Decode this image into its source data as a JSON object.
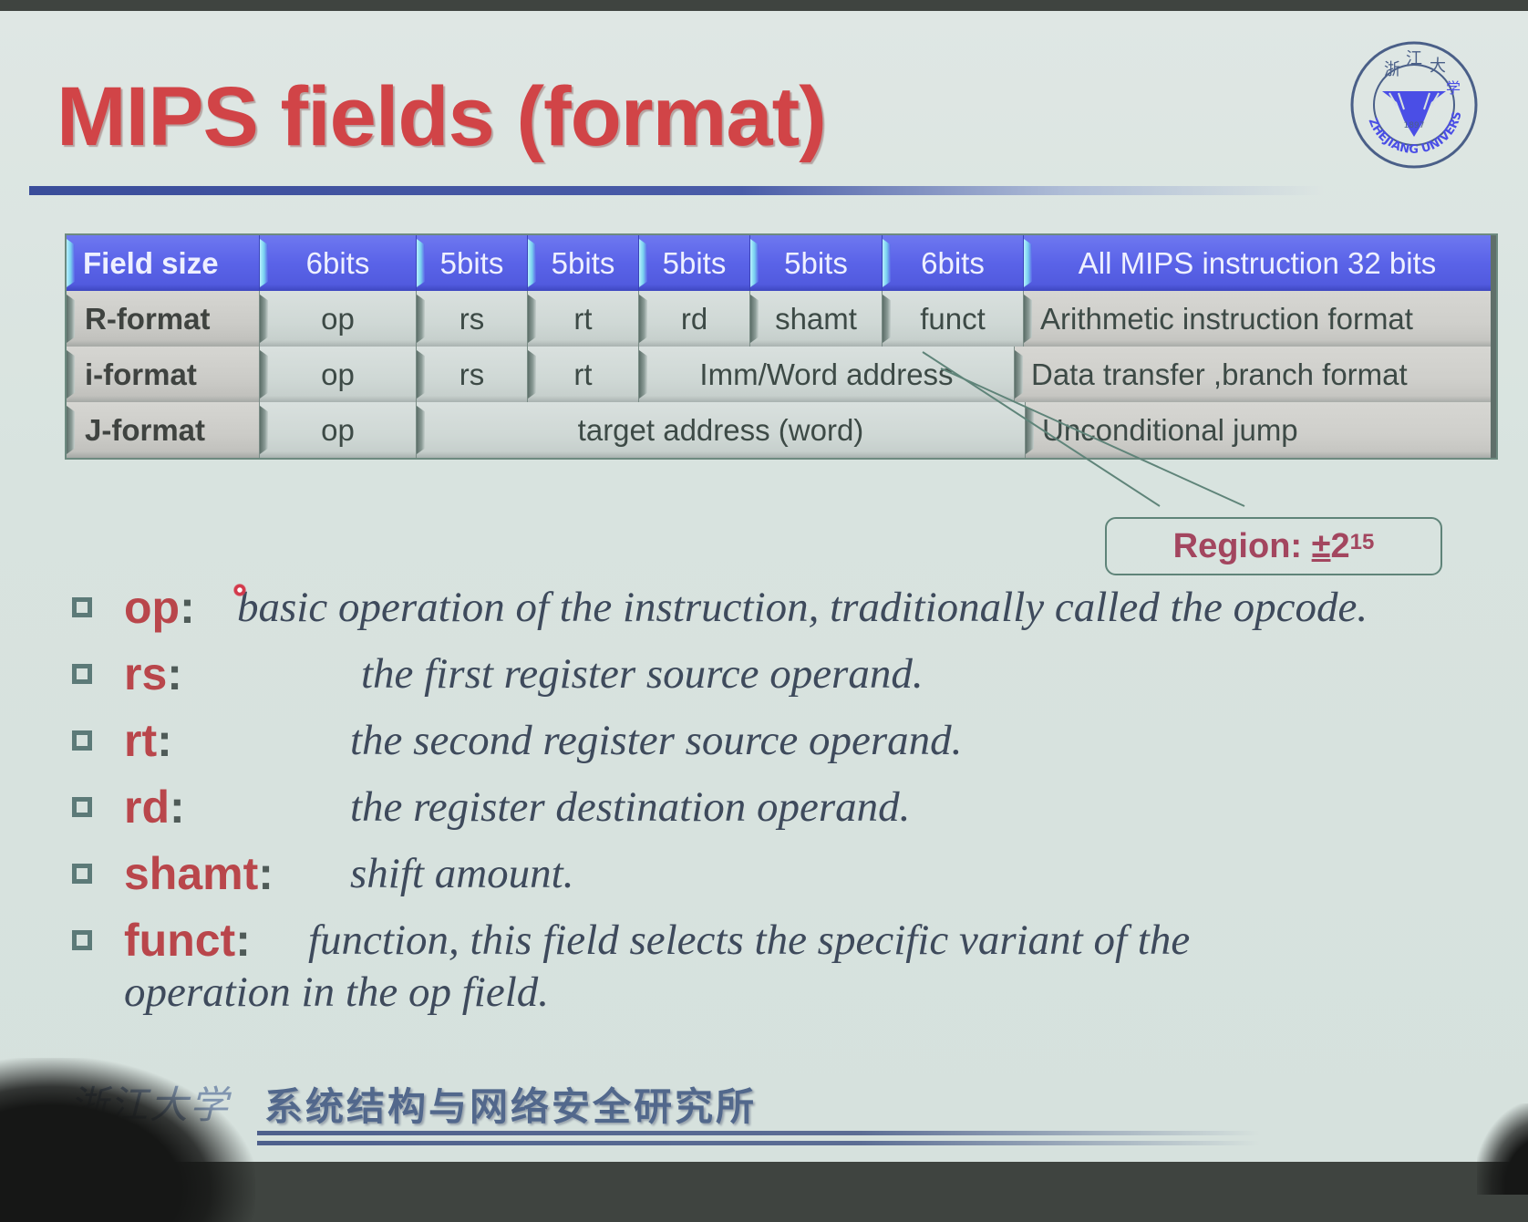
{
  "slide": {
    "title": "MIPS fields (format)",
    "logo": {
      "icon": "zhejiang-university-seal-icon",
      "text": "ZHEJIANG UNIVERSITY",
      "year": "1897",
      "accent": "#4a4ee6"
    },
    "colors": {
      "title": "#d14447",
      "header_fill": "#5a63e8",
      "key_text": "#b9464b",
      "desc_text": "#3e4a5c",
      "callout_text": "#a3465f"
    }
  },
  "table": {
    "header": {
      "label": "Field size",
      "cells": [
        "6bits",
        "5bits",
        "5bits",
        "5bits",
        "5bits",
        "6bits"
      ],
      "desc": "All MIPS instruction 32 bits"
    },
    "rows": [
      {
        "label": "R-format",
        "cells": [
          "op",
          "rs",
          "rt",
          "rd",
          "shamt",
          "funct"
        ],
        "desc": "Arithmetic instruction format"
      },
      {
        "label": "i-format",
        "cells": [
          "op",
          "rs",
          "rt",
          "Imm/Word address"
        ],
        "desc": "Data transfer ,branch format"
      },
      {
        "label": "J-format",
        "cells": [
          "op",
          "target address (word)"
        ],
        "desc": "Unconditional jump"
      }
    ]
  },
  "callout": {
    "prefix": "Region: ",
    "plusminus": "±",
    "base": "2",
    "exponent": "15"
  },
  "bullets": [
    {
      "key": "op",
      "colon": ":",
      "desc": "basic operation of the instruction, traditionally called the opcode."
    },
    {
      "key": "rs",
      "colon": ":",
      "desc": "the first register source operand."
    },
    {
      "key": "rt",
      "colon": ":",
      "desc": "the second register source operand."
    },
    {
      "key": "rd",
      "colon": ":",
      "desc": "the register destination operand."
    },
    {
      "key": "shamt",
      "colon": ":",
      "desc": "shift amount."
    },
    {
      "key": "funct",
      "colon": ":",
      "desc": "function, this field selects the specific variant of the",
      "desc_cont": "operation in the op field."
    }
  ],
  "footer": {
    "brand": "浙江大学",
    "institute": "系统结构与网络安全研究所"
  }
}
